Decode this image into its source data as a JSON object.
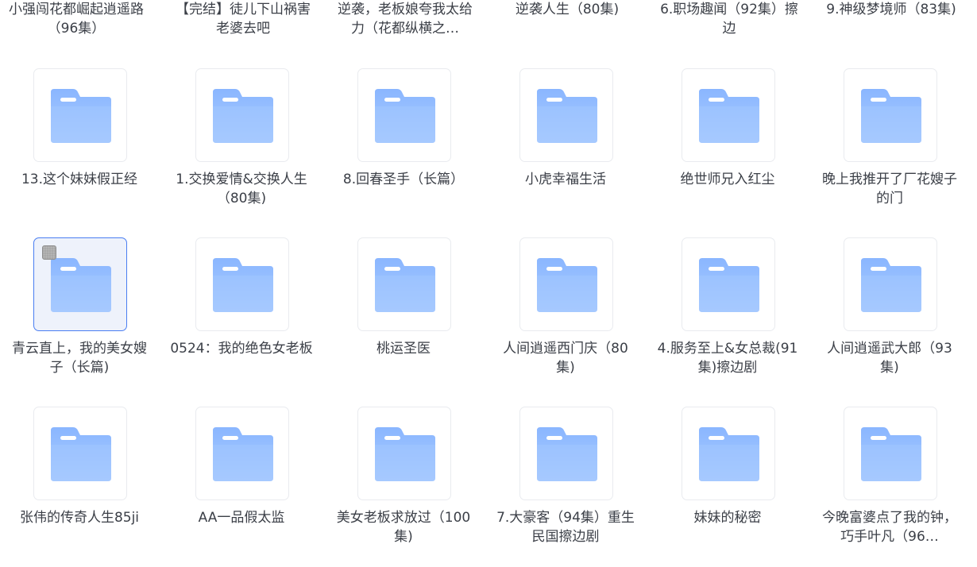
{
  "top_row": [
    "小强闯花都崛起逍遥路（96集）",
    "【完结】徒儿下山祸害老婆去吧",
    "逆袭，老板娘夸我太给力（花都纵横之…",
    "逆袭人生（80集)",
    "6.职场趣闻（92集）擦边",
    "9.神级梦境师（83集)"
  ],
  "rows": [
    [
      {
        "name": "13.这个妹妹假正经"
      },
      {
        "name": "1.交换爱情&交换人生（80集)"
      },
      {
        "name": "8.回春圣手（长篇）"
      },
      {
        "name": "小虎幸福生活"
      },
      {
        "name": "绝世师兄入红尘"
      },
      {
        "name": "晚上我推开了厂花嫂子的门"
      }
    ],
    [
      {
        "name": "青云直上，我的美女嫂子（长篇)",
        "selected": true
      },
      {
        "name": "0524：我的绝色女老板"
      },
      {
        "name": "桃运圣医"
      },
      {
        "name": "人间逍遥西门庆（80集)"
      },
      {
        "name": "4.服务至上&女总裁(91集)擦边剧"
      },
      {
        "name": "人间逍遥武大郎（93集)"
      }
    ],
    [
      {
        "name": "张伟的传奇人生85ji"
      },
      {
        "name": "AA一品假太监"
      },
      {
        "name": "美女老板求放过（100集)"
      },
      {
        "name": "7.大豪客（94集）重生民国擦边剧"
      },
      {
        "name": "妹妹的秘密"
      },
      {
        "name": "今晚富婆点了我的钟，巧手叶凡（96…"
      }
    ]
  ],
  "icons": {
    "folder": "folder-icon",
    "checkbox": "checkbox-icon"
  },
  "colors": {
    "folder_light": "#abcdff",
    "folder_dark": "#8ab6ff",
    "selected_border": "#4a7ef2",
    "selected_bg": "#eef2fb",
    "text": "#3b3f47"
  }
}
